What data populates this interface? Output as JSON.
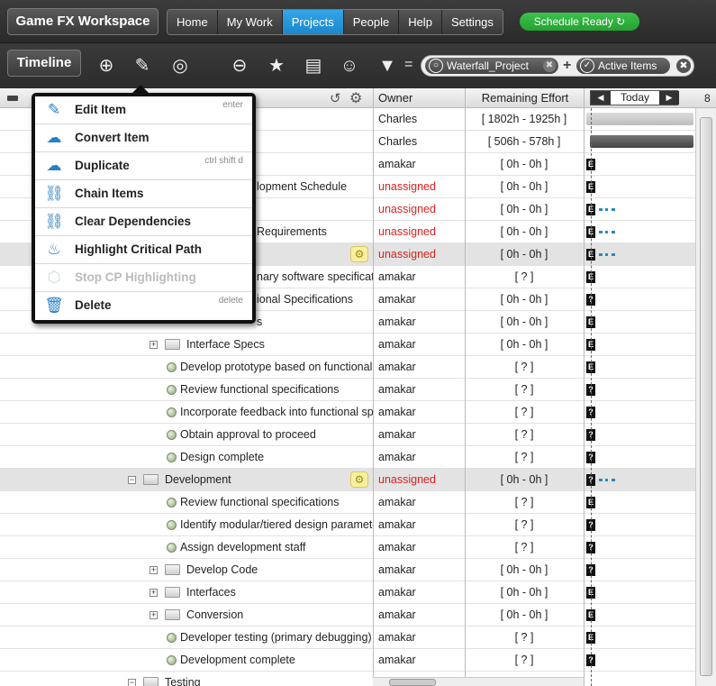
{
  "topbar": {
    "workspace": "Game FX Workspace",
    "nav": [
      "Home",
      "My Work",
      "Projects",
      "People",
      "Help",
      "Settings"
    ],
    "active_nav": "Projects",
    "status": "Schedule Ready"
  },
  "toolbar": {
    "view_label": "Timeline",
    "equals": "=",
    "filter": {
      "chip1": "Waterfall_Project",
      "plus": "+",
      "chip2": "Active Items"
    }
  },
  "columns": {
    "owner": "Owner",
    "effort": "Remaining Effort",
    "today": "Today",
    "timeline_tick": "8"
  },
  "menu": {
    "items": [
      {
        "label": "Edit Item",
        "shortcut": "enter",
        "icon": "pencil-icon"
      },
      {
        "label": "Convert Item",
        "shortcut": "",
        "icon": "cloud-icon"
      },
      {
        "label": "Duplicate",
        "shortcut": "ctrl shift d",
        "icon": "duplicate-icon"
      },
      {
        "label": "Chain Items",
        "shortcut": "",
        "icon": "chain-icon"
      },
      {
        "label": "Clear Dependencies",
        "shortcut": "",
        "icon": "broken-chain-icon"
      },
      {
        "label": "Highlight Critical Path",
        "shortcut": "",
        "icon": "flame-icon"
      },
      {
        "label": "Stop CP Highlighting",
        "shortcut": "",
        "icon": "hexagon-icon"
      },
      {
        "label": "Delete",
        "shortcut": "delete",
        "icon": "trash-icon"
      }
    ]
  },
  "rows": [
    {
      "name": "",
      "owner": "Charles",
      "effort": "[ 1802h - 1925h ]"
    },
    {
      "name": "",
      "owner": "Charles",
      "effort": "[ 506h - 578h ]"
    },
    {
      "name": "",
      "owner": "amakar",
      "effort": "[ 0h - 0h ]"
    },
    {
      "name": "lopment Schedule",
      "owner": "unassigned",
      "effort": "[ 0h - 0h ]"
    },
    {
      "name": "",
      "owner": "unassigned",
      "effort": "[ 0h - 0h ]"
    },
    {
      "name": "Requirements",
      "owner": "unassigned",
      "effort": "[ 0h - 0h ]"
    },
    {
      "name": "",
      "owner": "unassigned",
      "effort": "[ 0h - 0h ]"
    },
    {
      "name": "nary software specificatio",
      "owner": "amakar",
      "effort": "[ ? ]"
    },
    {
      "name": "ional Specifications",
      "owner": "amakar",
      "effort": "[ 0h - 0h ]"
    },
    {
      "name": "s",
      "owner": "amakar",
      "effort": "[ 0h - 0h ]"
    },
    {
      "name": "Interface Specs",
      "owner": "amakar",
      "effort": "[ 0h - 0h ]"
    },
    {
      "name": "Develop prototype based on functional s",
      "owner": "amakar",
      "effort": "[ ? ]"
    },
    {
      "name": "Review functional specifications",
      "owner": "amakar",
      "effort": "[ ? ]"
    },
    {
      "name": "Incorporate feedback into functional spe",
      "owner": "amakar",
      "effort": "[ ? ]"
    },
    {
      "name": "Obtain approval to proceed",
      "owner": "amakar",
      "effort": "[ ? ]"
    },
    {
      "name": "Design complete",
      "owner": "amakar",
      "effort": "[ ? ]"
    },
    {
      "name": "Development",
      "owner": "unassigned",
      "effort": "[ 0h - 0h ]"
    },
    {
      "name": "Review functional specifications",
      "owner": "amakar",
      "effort": "[ ? ]"
    },
    {
      "name": "Identify modular/tiered design paramete",
      "owner": "amakar",
      "effort": "[ ? ]"
    },
    {
      "name": "Assign development staff",
      "owner": "amakar",
      "effort": "[ ? ]"
    },
    {
      "name": "Develop Code",
      "owner": "amakar",
      "effort": "[ 0h - 0h ]"
    },
    {
      "name": "Interfaces",
      "owner": "amakar",
      "effort": "[ 0h - 0h ]"
    },
    {
      "name": "Conversion",
      "owner": "amakar",
      "effort": "[ 0h - 0h ]"
    },
    {
      "name": "Developer testing (primary debugging)",
      "owner": "amakar",
      "effort": "[ ? ]"
    },
    {
      "name": "Development complete",
      "owner": "amakar",
      "effort": "[ ? ]"
    },
    {
      "name": "Testing",
      "owner": "",
      "effort": ""
    }
  ],
  "gantt_marks": [
    "E",
    "E",
    "E",
    "E",
    "E",
    "E",
    "?",
    "E",
    "E",
    "E",
    "?",
    "?",
    "?",
    "?",
    "?",
    "E",
    "?",
    "?",
    "?",
    "E",
    "E",
    "E",
    "?",
    "?"
  ]
}
